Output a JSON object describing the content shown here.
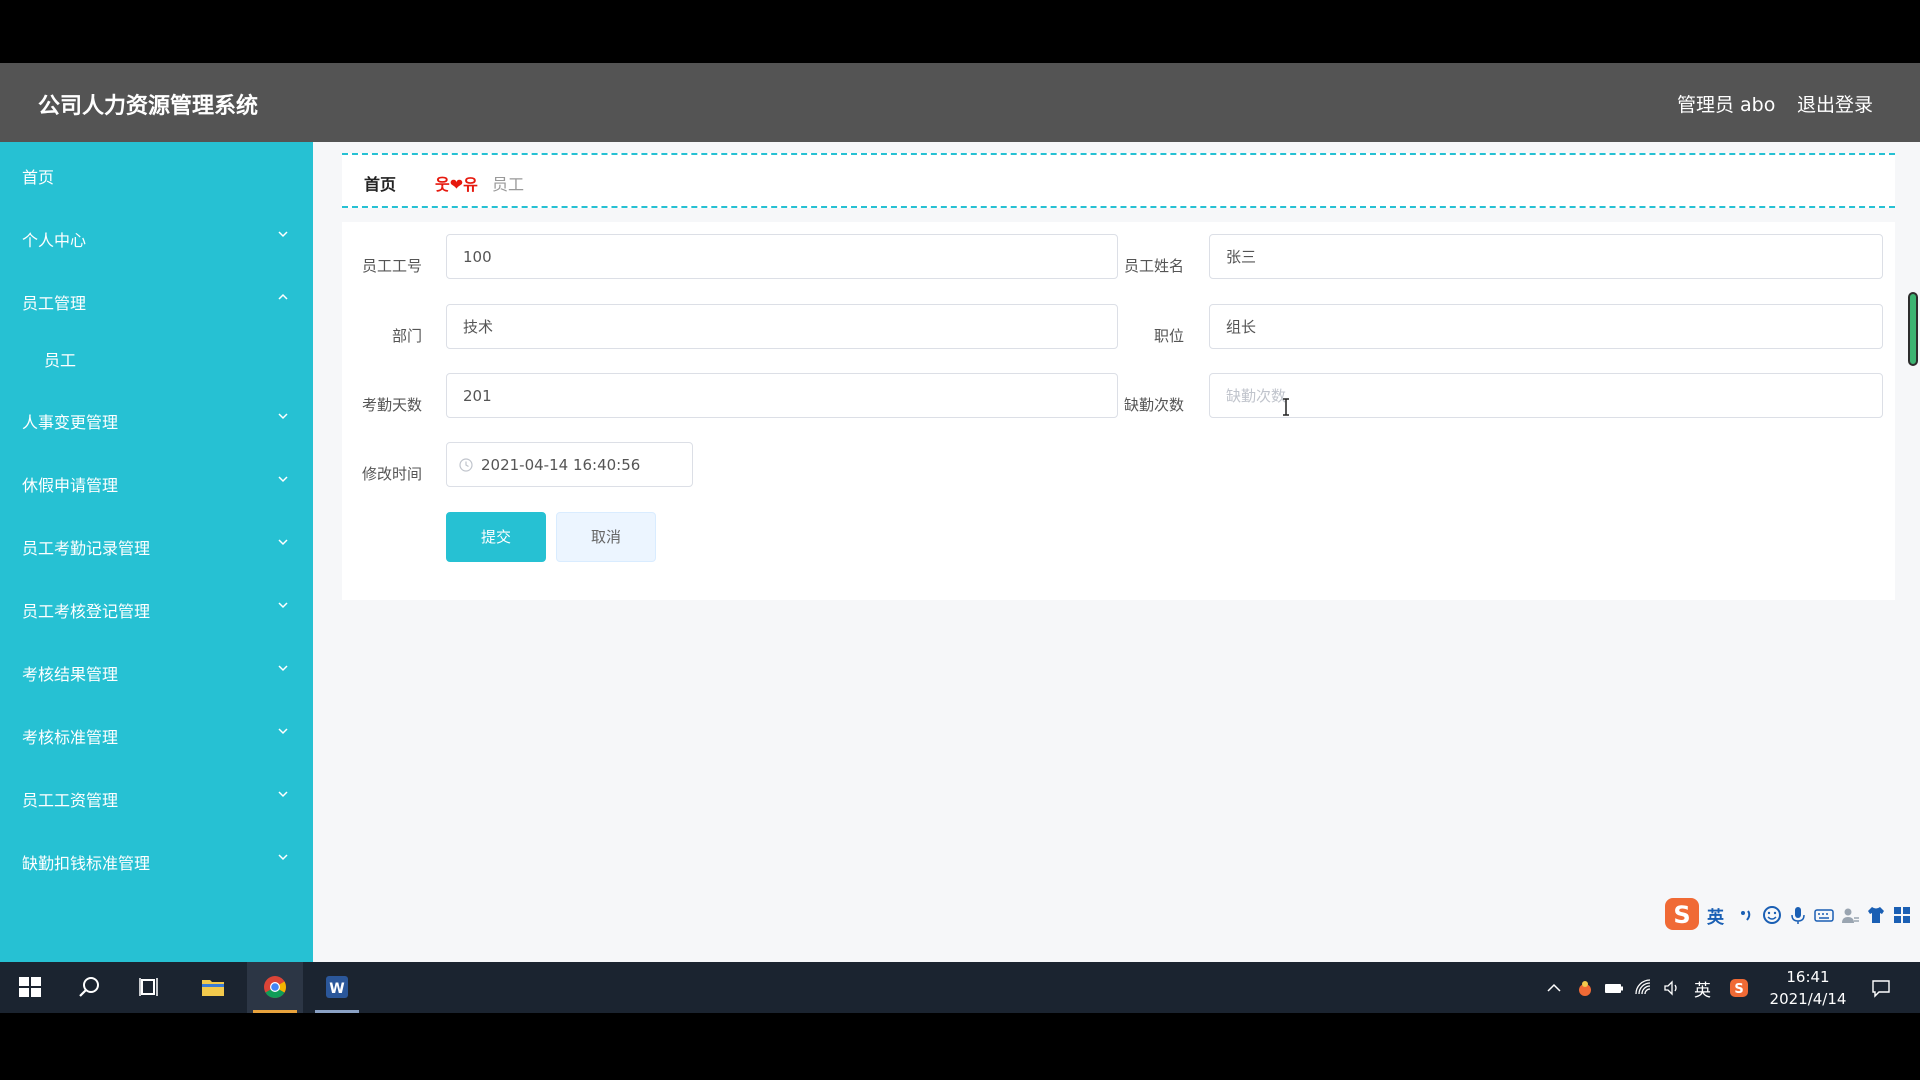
{
  "app": {
    "title": "公司人力资源管理系统",
    "user_label": "管理员 abo",
    "logout_label": "退出登录"
  },
  "sidebar": {
    "items": [
      {
        "label": "首页",
        "chevron": "none"
      },
      {
        "label": "个人中心",
        "chevron": "down"
      },
      {
        "label": "员工管理",
        "chevron": "up"
      },
      {
        "label": "员工",
        "chevron": "none",
        "sub": true
      },
      {
        "label": "人事变更管理",
        "chevron": "down"
      },
      {
        "label": "休假申请管理",
        "chevron": "down"
      },
      {
        "label": "员工考勤记录管理",
        "chevron": "down"
      },
      {
        "label": "员工考核登记管理",
        "chevron": "down"
      },
      {
        "label": "考核结果管理",
        "chevron": "down"
      },
      {
        "label": "考核标准管理",
        "chevron": "down"
      },
      {
        "label": "员工工资管理",
        "chevron": "down"
      },
      {
        "label": "缺勤扣钱标准管理",
        "chevron": "down"
      }
    ]
  },
  "breadcrumb": {
    "home": "首页",
    "separator": "웃❤유",
    "current": "员工"
  },
  "form": {
    "employee_no": {
      "label": "员工工号",
      "value": "100"
    },
    "employee_name": {
      "label": "员工姓名",
      "value": "张三"
    },
    "department": {
      "label": "部门",
      "value": "技术"
    },
    "position": {
      "label": "职位",
      "value": "组长"
    },
    "attendance_days": {
      "label": "考勤天数",
      "value": "201"
    },
    "absence_count": {
      "label": "缺勤次数",
      "value": "",
      "placeholder": "缺勤次数"
    },
    "modified_time": {
      "label": "修改时间",
      "value": "2021-04-14 16:40:56"
    },
    "submit_label": "提交",
    "cancel_label": "取消"
  },
  "ime": {
    "lang": "英"
  },
  "taskbar": {
    "tray_lang": "英",
    "time": "16:41",
    "date": "2021/4/14"
  },
  "colors": {
    "accent": "#26c1d3",
    "header_bg": "#545454",
    "content_bg": "#f6f7f9",
    "taskbar_bg": "#1b2430"
  }
}
